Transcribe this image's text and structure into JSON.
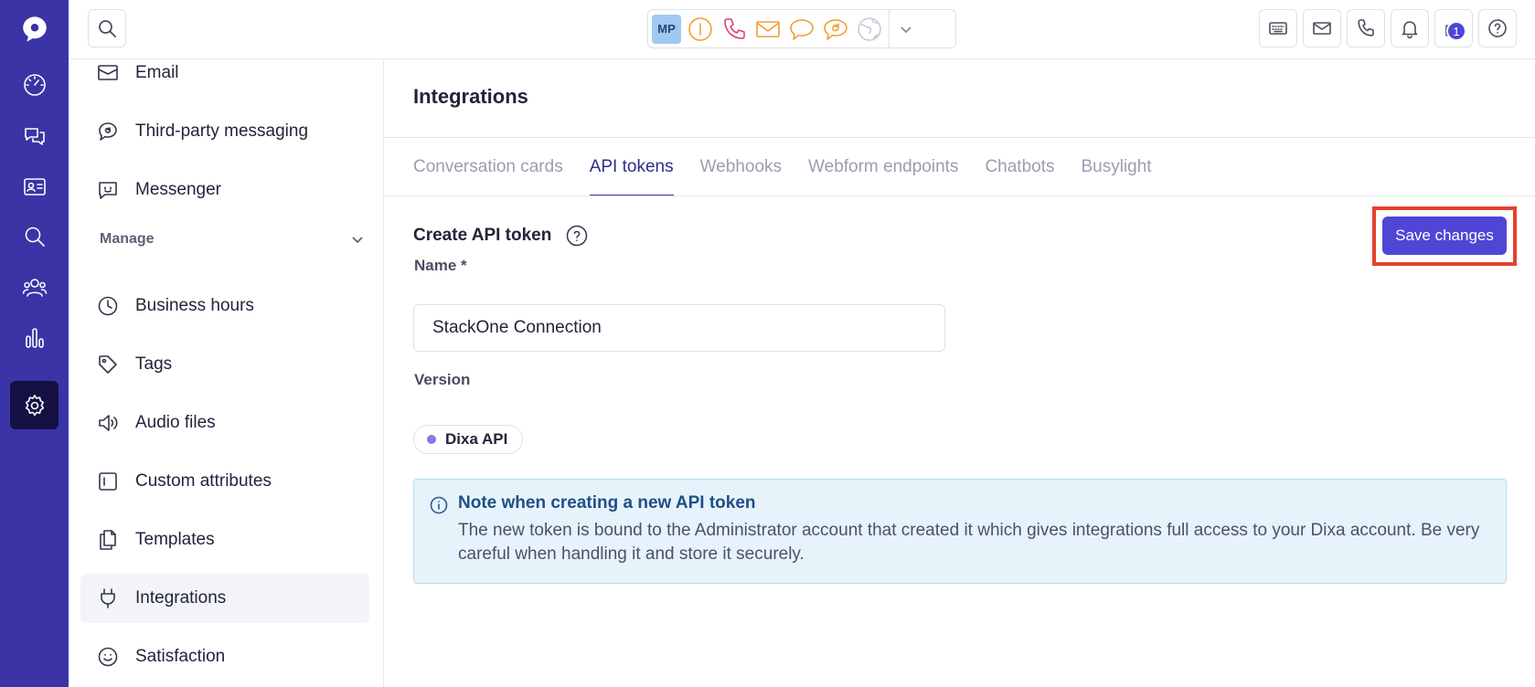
{
  "colors": {
    "rail_bg": "#3a34a6",
    "rail_active": "#151043",
    "primary_button": "#4f46d6",
    "highlight_border": "#e5402b",
    "note_bg": "#e7f3fb",
    "note_title": "#1f4f86",
    "status_orange": "#f0a030",
    "status_pink": "#e0406e"
  },
  "rail": {
    "items": [
      {
        "name": "dashboard",
        "icon": "gauge-icon"
      },
      {
        "name": "conversations",
        "icon": "chat-bubbles-icon"
      },
      {
        "name": "contacts",
        "icon": "contact-card-icon"
      },
      {
        "name": "search",
        "icon": "search-icon"
      },
      {
        "name": "team",
        "icon": "users-icon"
      },
      {
        "name": "analytics",
        "icon": "bar-chart-icon"
      },
      {
        "name": "settings",
        "icon": "gear-icon",
        "active": true
      }
    ]
  },
  "topbar": {
    "avatar_initials": "MP",
    "status_icons": [
      "busy-status-icon",
      "phone-icon",
      "email-icon",
      "chat-icon",
      "callback-icon",
      "globe-icon"
    ],
    "right_tools": [
      "keyboard-icon",
      "email-icon",
      "phone-icon",
      "bell-icon",
      "gift-icon",
      "help-icon"
    ],
    "notification_count": "1"
  },
  "sidebar": {
    "items_top": [
      {
        "label": "Email",
        "icon": "envelope-icon"
      },
      {
        "label": "Third-party messaging",
        "icon": "message-sync-icon"
      },
      {
        "label": "Messenger",
        "icon": "messenger-icon"
      }
    ],
    "section_label": "Manage",
    "items_manage": [
      {
        "label": "Business hours",
        "icon": "clock-icon"
      },
      {
        "label": "Tags",
        "icon": "tag-icon"
      },
      {
        "label": "Audio files",
        "icon": "speaker-icon"
      },
      {
        "label": "Custom attributes",
        "icon": "attributes-icon"
      },
      {
        "label": "Templates",
        "icon": "documents-icon"
      },
      {
        "label": "Integrations",
        "icon": "plug-icon",
        "active": true
      },
      {
        "label": "Satisfaction",
        "icon": "smiley-icon"
      }
    ]
  },
  "main": {
    "title": "Integrations",
    "tabs": [
      {
        "label": "Conversation cards"
      },
      {
        "label": "API tokens",
        "active": true
      },
      {
        "label": "Webhooks"
      },
      {
        "label": "Webform endpoints"
      },
      {
        "label": "Chatbots"
      },
      {
        "label": "Busylight"
      }
    ],
    "section_title": "Create API token",
    "save_label": "Save changes",
    "name_label": "Name *",
    "name_value": "StackOne Connection",
    "version_label": "Version",
    "version_value": "Dixa API",
    "note_title": "Note when creating a new API token",
    "note_body": "The new token is bound to the Administrator account that created it which gives integrations full access to your Dixa account. Be very careful when handling it and store it securely."
  }
}
